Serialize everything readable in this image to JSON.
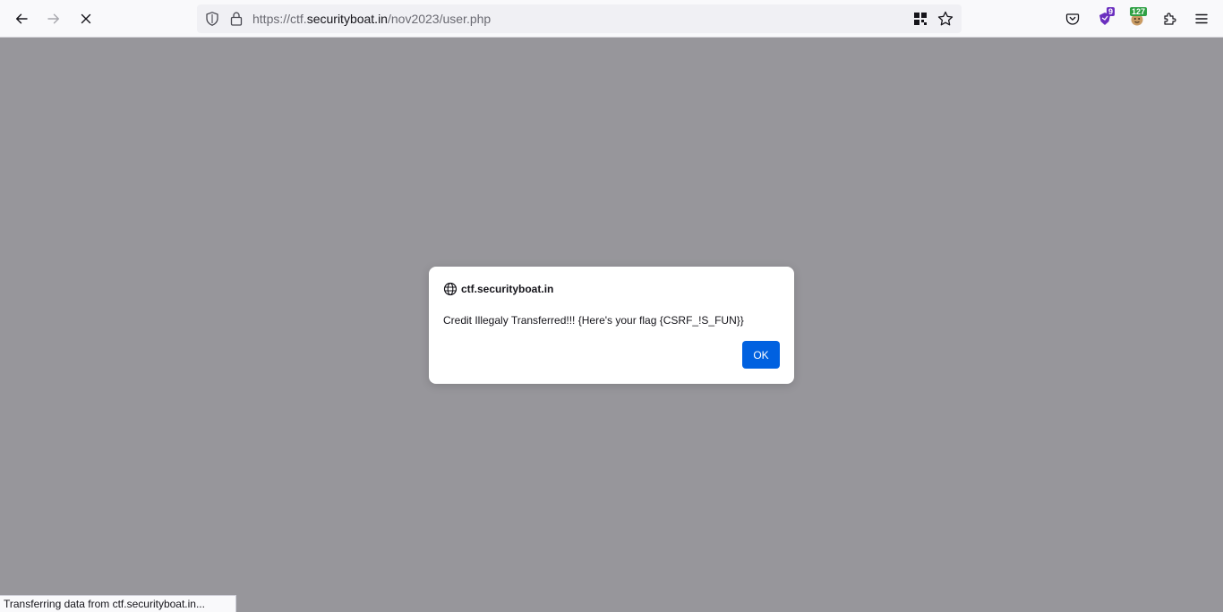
{
  "browser": {
    "url": {
      "prefix": "https://ctf.",
      "host": "securityboat.in",
      "path": "/nov2023/user.php"
    },
    "nav": {
      "back_icon": "arrow-left-icon",
      "forward_icon": "arrow-right-icon",
      "stop_icon": "close-icon"
    },
    "extensions": [
      {
        "name": "pocket-icon"
      },
      {
        "name": "extension-shield-icon",
        "badge": "9",
        "badge_color": "#6b2fbf"
      },
      {
        "name": "extension-face-icon",
        "badge": "127",
        "badge_color": "#2ea043"
      },
      {
        "name": "puzzle-icon"
      },
      {
        "name": "menu-icon"
      }
    ]
  },
  "page": {
    "background": "#97969b"
  },
  "dialog": {
    "origin": "ctf.securityboat.in",
    "message": "Credit Illegaly Transferred!!! {Here's your flag {CSRF_!S_FUN}}",
    "ok_label": "OK",
    "accent": "#0061e0"
  },
  "status_bar": {
    "text": "Transferring data from ctf.securityboat.in..."
  }
}
